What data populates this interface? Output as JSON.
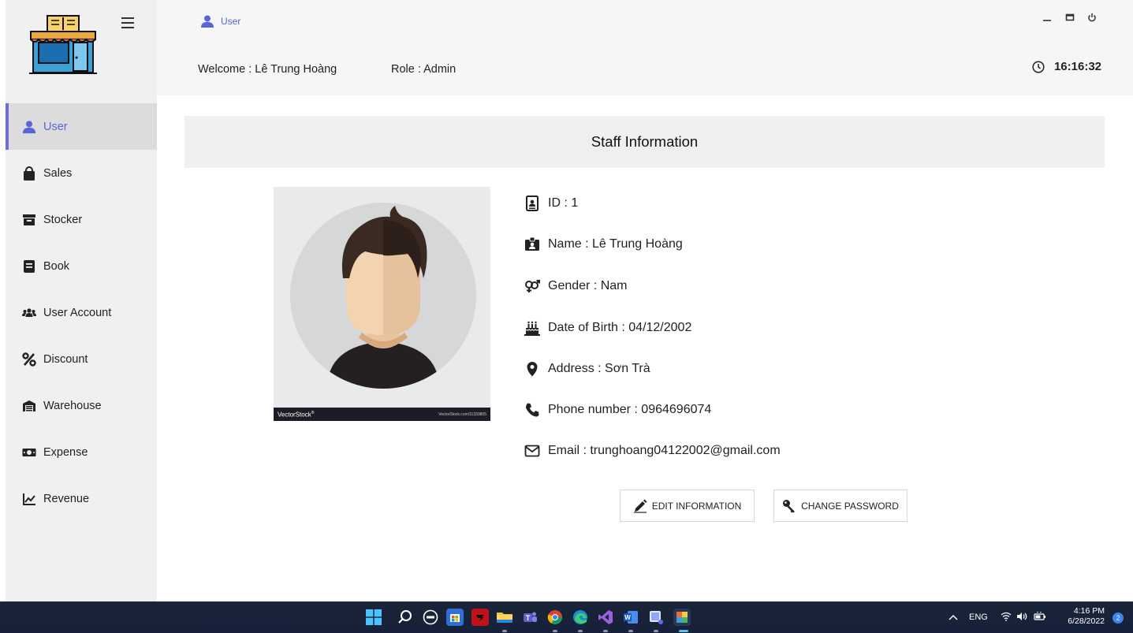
{
  "breadcrumb": {
    "label": "User",
    "icon": "user-icon"
  },
  "header": {
    "welcome": "Welcome :  Lê Trung Hoàng",
    "role": "Role : Admin",
    "time": "16:16:32"
  },
  "sidebar": {
    "items": [
      {
        "label": "User",
        "icon": "user-icon",
        "active": true
      },
      {
        "label": "Sales",
        "icon": "shopping-bag-icon"
      },
      {
        "label": "Stocker",
        "icon": "archive-box-icon"
      },
      {
        "label": "Book",
        "icon": "book-icon"
      },
      {
        "label": "User Account",
        "icon": "users-icon"
      },
      {
        "label": "Discount",
        "icon": "percent-icon"
      },
      {
        "label": "Warehouse",
        "icon": "warehouse-icon"
      },
      {
        "label": "Expense",
        "icon": "money-bill-icon"
      },
      {
        "label": "Revenue",
        "icon": "chart-line-icon"
      }
    ]
  },
  "section_title": "Staff Information",
  "avatar": {
    "brand": "VectorStock",
    "brand_suffix": "®",
    "credit": "VectorStock.com/11333805"
  },
  "info": {
    "id": "ID :  1",
    "name": "Name :  Lê Trung Hoàng",
    "gender": "Gender :  Nam",
    "dob": "Date of Birth :  04/12/2002",
    "address": "Address :  Sơn Trà",
    "phone": "Phone number : 0964696074",
    "email": "Email :  trunghoang04122002@gmail.com"
  },
  "buttons": {
    "edit": "EDIT INFORMATION",
    "change_password": "CHANGE PASSWORD"
  },
  "taskbar": {
    "lang": "ENG",
    "time": "4:16 PM",
    "date": "6/28/2022",
    "notifications": "2"
  },
  "colors": {
    "accent": "#5865d8",
    "sidebar_bg": "#f0f0f0",
    "topbar_bg": "#f6f6f6"
  }
}
